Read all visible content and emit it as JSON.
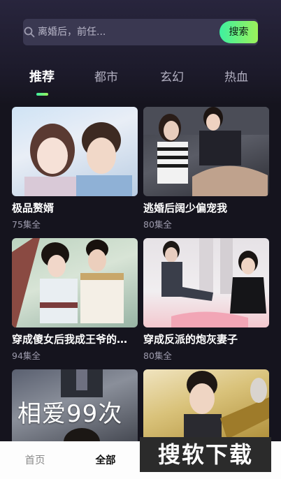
{
  "search": {
    "placeholder": "离婚后，前任...",
    "button_label": "搜索"
  },
  "tabs": [
    {
      "label": "推荐",
      "active": true
    },
    {
      "label": "都市"
    },
    {
      "label": "玄幻"
    },
    {
      "label": "热血"
    }
  ],
  "dramas": [
    {
      "title": "极品赘婿",
      "episodes": "75集全"
    },
    {
      "title": "逃婚后阔少偏宠我",
      "episodes": "80集全"
    },
    {
      "title": "穿成傻女后我成王爷的心尖宠",
      "episodes": "94集全"
    },
    {
      "title": "穿成反派的炮灰妻子",
      "episodes": "80集全"
    },
    {
      "title": "",
      "episodes": "",
      "poster_text": "相爱99次"
    },
    {
      "title": "",
      "episodes": ""
    }
  ],
  "bottom_nav": [
    {
      "label": "首页"
    },
    {
      "label": "全部",
      "active": true
    }
  ],
  "watermark": "搜软下载",
  "colors": {
    "accent_start": "#3ef0a0",
    "accent_end": "#9cf25a",
    "background": "#15141e"
  }
}
